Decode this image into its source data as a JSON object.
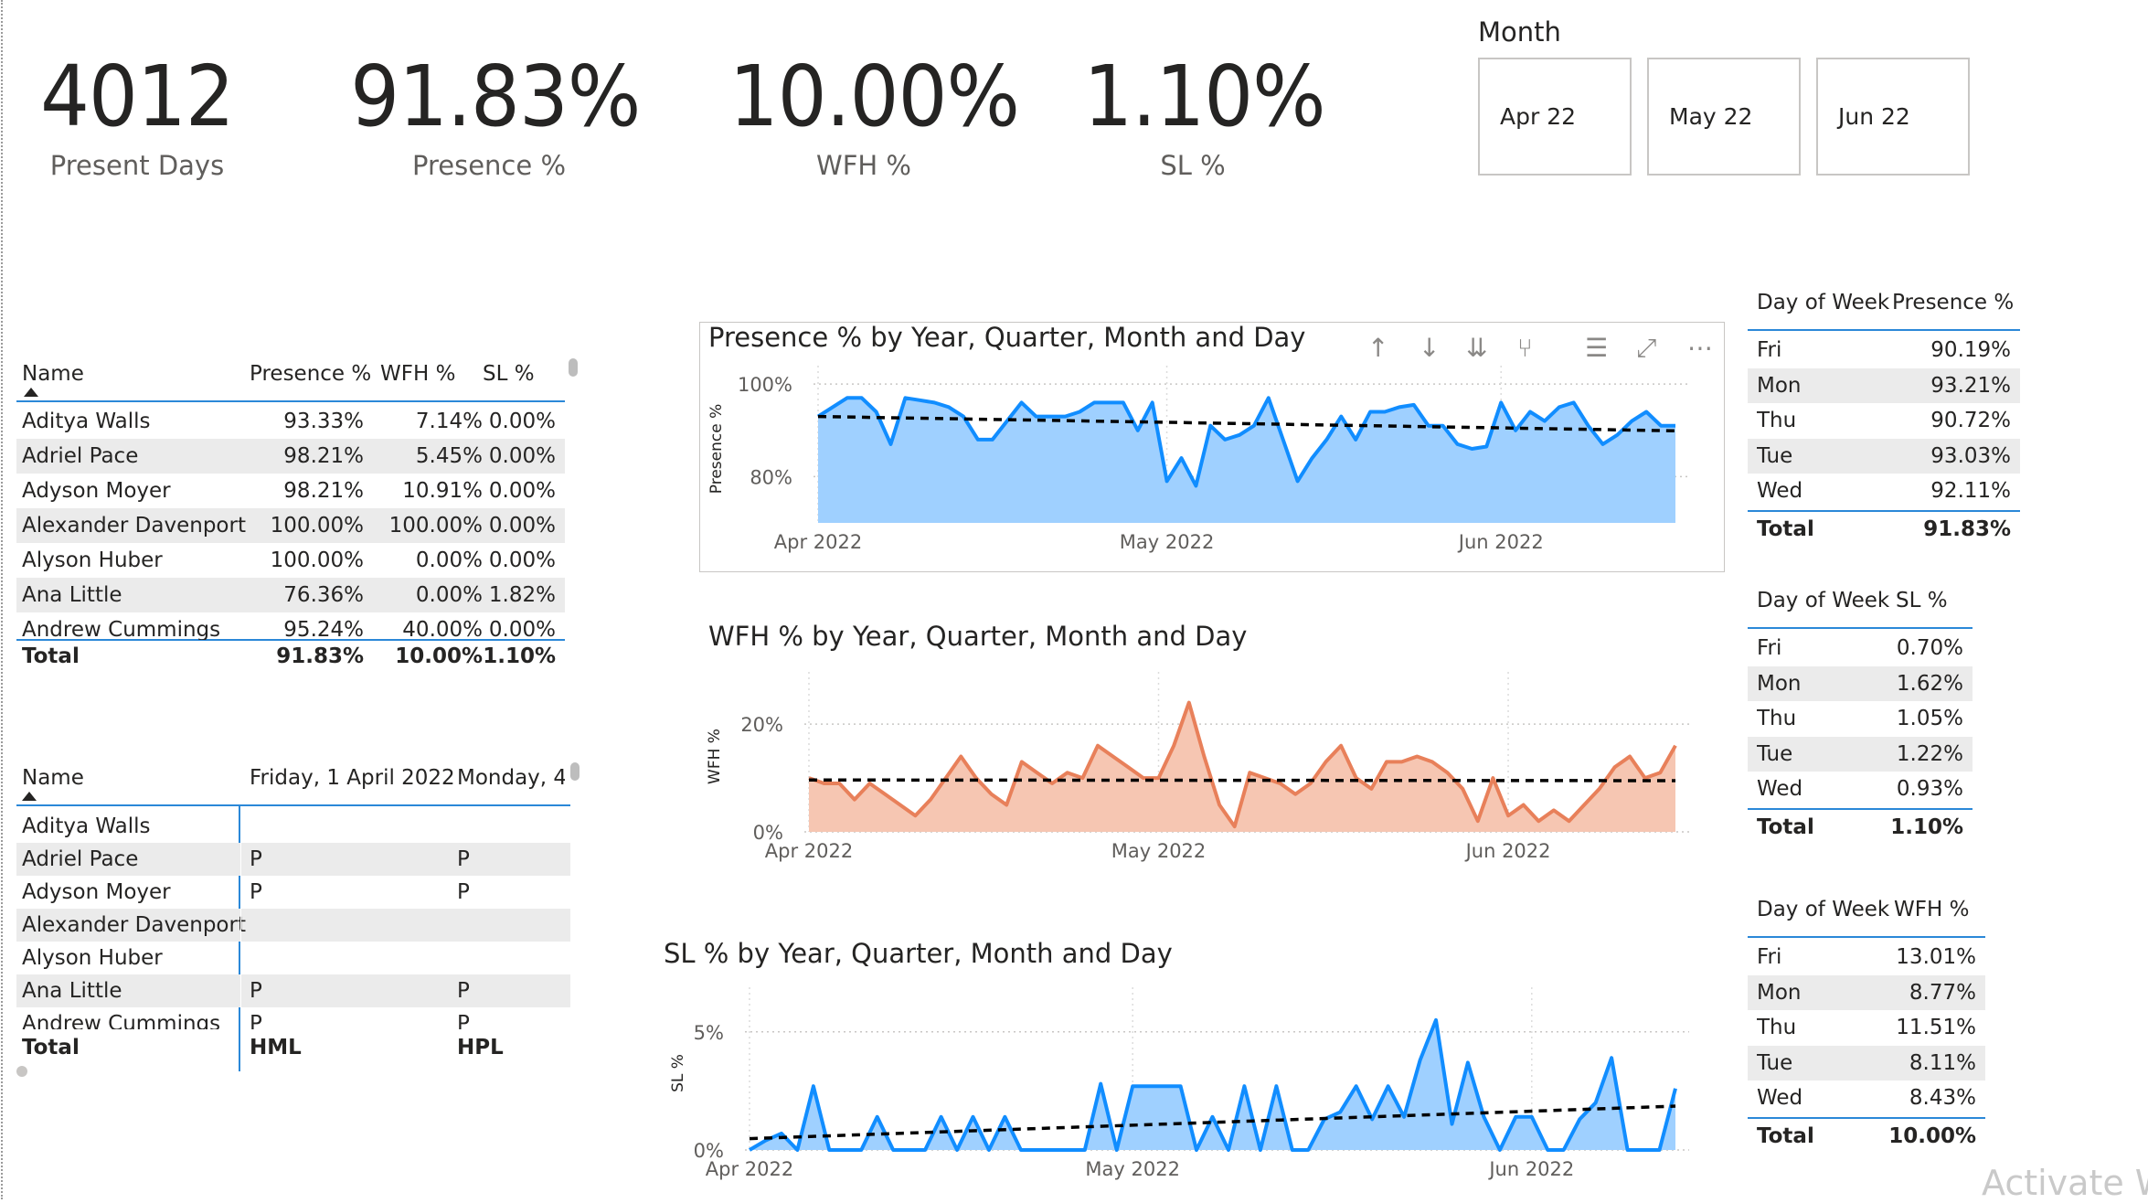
{
  "kpis": [
    {
      "value": "4012",
      "label": "Present Days"
    },
    {
      "value": "91.83%",
      "label": "Presence %"
    },
    {
      "value": "10.00%",
      "label": "WFH %"
    },
    {
      "value": "1.10%",
      "label": "SL %"
    }
  ],
  "month_slicer": {
    "title": "Month",
    "options": [
      "Apr 22",
      "May 22",
      "Jun 22"
    ]
  },
  "employee_table": {
    "headers": [
      "Name",
      "Presence %",
      "WFH %",
      "SL %"
    ],
    "rows": [
      [
        "Aditya Walls",
        "93.33%",
        "7.14%",
        "0.00%"
      ],
      [
        "Adriel Pace",
        "98.21%",
        "5.45%",
        "0.00%"
      ],
      [
        "Adyson Moyer",
        "98.21%",
        "10.91%",
        "0.00%"
      ],
      [
        "Alexander Davenport",
        "100.00%",
        "100.00%",
        "0.00%"
      ],
      [
        "Alyson Huber",
        "100.00%",
        "0.00%",
        "0.00%"
      ],
      [
        "Ana Little",
        "76.36%",
        "0.00%",
        "1.82%"
      ],
      [
        "Andrew Cummings",
        "95.24%",
        "40.00%",
        "0.00%"
      ]
    ],
    "total": [
      "Total",
      "91.83%",
      "10.00%",
      "1.10%"
    ]
  },
  "attendance_matrix": {
    "headers": [
      "Name",
      "Friday, 1 April 2022",
      "Monday, 4"
    ],
    "rows": [
      [
        "Aditya Walls",
        "",
        ""
      ],
      [
        "Adriel Pace",
        "P",
        "P"
      ],
      [
        "Adyson Moyer",
        "P",
        "P"
      ],
      [
        "Alexander Davenport",
        "",
        ""
      ],
      [
        "Alyson Huber",
        "",
        ""
      ],
      [
        "Ana Little",
        "P",
        "P"
      ],
      [
        "Andrew Cummings",
        "P",
        "P"
      ]
    ],
    "total": [
      "Total",
      "HML",
      "HPL"
    ]
  },
  "dow_presence": {
    "headers": [
      "Day of Week",
      "Presence %"
    ],
    "rows": [
      [
        "Fri",
        "90.19%"
      ],
      [
        "Mon",
        "93.21%"
      ],
      [
        "Thu",
        "90.72%"
      ],
      [
        "Tue",
        "93.03%"
      ],
      [
        "Wed",
        "92.11%"
      ]
    ],
    "total": [
      "Total",
      "91.83%"
    ]
  },
  "dow_sl": {
    "headers": [
      "Day of Week",
      "SL %"
    ],
    "rows": [
      [
        "Fri",
        "0.70%"
      ],
      [
        "Mon",
        "1.62%"
      ],
      [
        "Thu",
        "1.05%"
      ],
      [
        "Tue",
        "1.22%"
      ],
      [
        "Wed",
        "0.93%"
      ]
    ],
    "total": [
      "Total",
      "1.10%"
    ]
  },
  "dow_wfh": {
    "headers": [
      "Day of Week",
      "WFH %"
    ],
    "rows": [
      [
        "Fri",
        "13.01%"
      ],
      [
        "Mon",
        "8.77%"
      ],
      [
        "Thu",
        "11.51%"
      ],
      [
        "Tue",
        "8.11%"
      ],
      [
        "Wed",
        "8.43%"
      ]
    ],
    "total": [
      "Total",
      "10.00%"
    ]
  },
  "toolbar_icons": [
    "arrow-up-icon",
    "arrow-down-icon",
    "double-arrow-down-icon",
    "expand-hierarchy-icon",
    "filter-icon",
    "focus-mode-icon",
    "more-options-icon"
  ],
  "watermark": "Activate W",
  "colors": {
    "presence": "#118dff",
    "presence_fill": "#9fd0ff",
    "wfh": "#e8805a",
    "wfh_fill": "#f6c6b2",
    "sl": "#118dff",
    "sl_fill": "#9fd0ff",
    "trend": "#000000",
    "accent_line": "#2b88d8"
  },
  "chart_data": [
    {
      "type": "area",
      "title": "Presence % by Year, Quarter, Month and Day",
      "ylabel": "Presence %",
      "yticks": [
        "100%",
        "80%"
      ],
      "ylim": [
        70,
        102
      ],
      "xticks": [
        "Apr 2022",
        "May 2022",
        "Jun 2022"
      ],
      "trendline": true,
      "series": [
        {
          "values": [
            93,
            95,
            97,
            97,
            94,
            87,
            97,
            96.5,
            96,
            95,
            93,
            88,
            88,
            92,
            96,
            93,
            93,
            93,
            94,
            96,
            96,
            96,
            90,
            96,
            79,
            84,
            78,
            91,
            88,
            89,
            91,
            97,
            88,
            79,
            84,
            88,
            93,
            88,
            94,
            94,
            95,
            95.5,
            91,
            91,
            87,
            86,
            86.5,
            96,
            90,
            94,
            92,
            95,
            96,
            91,
            87,
            89,
            92,
            94,
            91,
            91
          ]
        }
      ]
    },
    {
      "type": "area",
      "title": "WFH % by Year, Quarter, Month and Day",
      "ylabel": "WFH %",
      "yticks": [
        "20%",
        "0%"
      ],
      "ylim": [
        0,
        28
      ],
      "xticks": [
        "Apr 2022",
        "May 2022",
        "Jun 2022"
      ],
      "trendline": true,
      "series": [
        {
          "values": [
            10,
            9,
            9,
            6,
            9,
            7,
            5,
            3,
            6,
            10,
            14,
            10,
            7,
            5,
            13,
            11,
            9,
            11,
            10,
            16,
            14,
            12,
            10,
            10,
            16,
            24,
            14,
            5,
            1,
            11,
            10,
            9,
            7,
            9,
            13,
            16,
            10,
            8,
            13,
            13,
            14,
            13,
            11,
            8,
            2,
            10,
            3,
            5,
            2,
            4,
            2,
            5,
            8,
            12,
            14,
            10,
            11,
            16
          ]
        }
      ]
    },
    {
      "type": "area",
      "title": "SL % by Year, Quarter, Month and Day",
      "ylabel": "SL %",
      "yticks": [
        "5%",
        "0%"
      ],
      "ylim": [
        0,
        6.5
      ],
      "xticks": [
        "Apr 2022",
        "May 2022",
        "Jun 2022"
      ],
      "trendline": true,
      "series": [
        {
          "values": [
            0,
            0.4,
            0.7,
            0,
            2.7,
            0,
            0,
            0,
            1.4,
            0,
            0,
            0,
            1.4,
            0,
            1.4,
            0,
            1.4,
            0,
            0,
            0,
            0,
            0,
            2.8,
            0,
            2.7,
            2.7,
            2.7,
            2.7,
            0,
            1.4,
            0,
            2.7,
            0,
            2.7,
            0,
            0,
            1.3,
            1.6,
            2.7,
            1.3,
            2.7,
            1.4,
            3.8,
            5.5,
            1.1,
            3.7,
            1.4,
            0,
            1.4,
            1.4,
            0,
            0,
            1.3,
            2.0,
            3.9,
            0,
            0,
            0,
            2.6
          ]
        }
      ]
    }
  ]
}
